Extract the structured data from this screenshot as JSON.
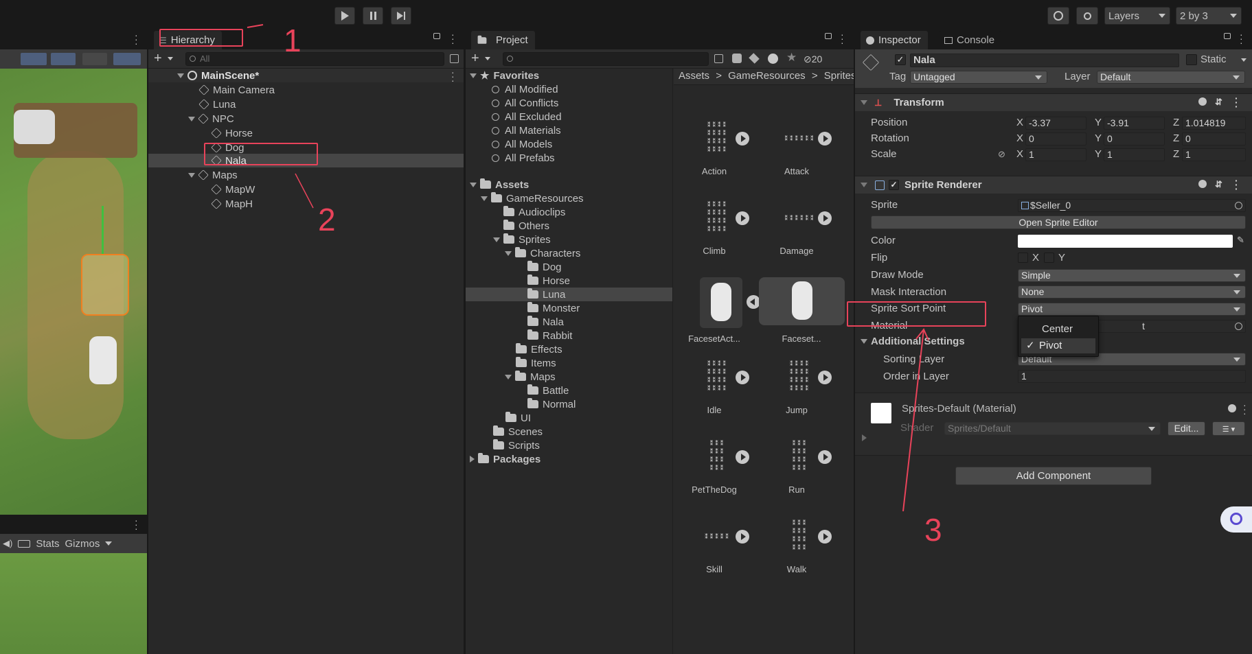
{
  "toolbar": {
    "layers_label": "Layers",
    "layout_label": "2 by 3"
  },
  "scene_view": {
    "bottom_bar": {
      "stats": "Stats",
      "gizmos": "Gizmos"
    }
  },
  "hierarchy": {
    "tab": "Hierarchy",
    "search_placeholder": "All",
    "scene_name": "MainScene*",
    "items": [
      {
        "label": "Main Camera",
        "depth": 1
      },
      {
        "label": "Luna",
        "depth": 1
      },
      {
        "label": "NPC",
        "depth": 1,
        "folded": false
      },
      {
        "label": "Horse",
        "depth": 2
      },
      {
        "label": "Dog",
        "depth": 2
      },
      {
        "label": "Nala",
        "depth": 2,
        "selected": true
      },
      {
        "label": "Maps",
        "depth": 1,
        "folded": false
      },
      {
        "label": "MapW",
        "depth": 2
      },
      {
        "label": "MapH",
        "depth": 2
      }
    ]
  },
  "project": {
    "tab": "Project",
    "hidden_count": "20",
    "favorites_label": "Favorites",
    "favorites": [
      "All Modified",
      "All Conflicts",
      "All Excluded",
      "All Materials",
      "All Models",
      "All Prefabs"
    ],
    "assets_label": "Assets",
    "tree": [
      {
        "label": "GameResources",
        "depth": 1,
        "open": true
      },
      {
        "label": "Audioclips",
        "depth": 2
      },
      {
        "label": "Others",
        "depth": 2
      },
      {
        "label": "Sprites",
        "depth": 2,
        "open": true
      },
      {
        "label": "Characters",
        "depth": 3,
        "open": true
      },
      {
        "label": "Dog",
        "depth": 4
      },
      {
        "label": "Horse",
        "depth": 4
      },
      {
        "label": "Luna",
        "depth": 4,
        "selected": true
      },
      {
        "label": "Monster",
        "depth": 4
      },
      {
        "label": "Nala",
        "depth": 4
      },
      {
        "label": "Rabbit",
        "depth": 4
      },
      {
        "label": "Effects",
        "depth": 3
      },
      {
        "label": "Items",
        "depth": 3
      },
      {
        "label": "Maps",
        "depth": 3,
        "open": true
      },
      {
        "label": "Battle",
        "depth": 4
      },
      {
        "label": "Normal",
        "depth": 4
      },
      {
        "label": "UI",
        "depth": 2
      },
      {
        "label": "Scenes",
        "depth": 1
      },
      {
        "label": "Scripts",
        "depth": 1
      }
    ],
    "packages_label": "Packages",
    "breadcrumb": [
      "Assets",
      "GameResources",
      "Sprites"
    ],
    "breadcrumb_sep": ">",
    "grid": [
      {
        "label": "Action"
      },
      {
        "label": "Attack"
      },
      {
        "label": "Climb"
      },
      {
        "label": "Damage"
      },
      {
        "label": "FacesetAct..."
      },
      {
        "label": "Faceset..."
      },
      {
        "label": "Idle"
      },
      {
        "label": "Jump"
      },
      {
        "label": "PetTheDog"
      },
      {
        "label": "Run"
      },
      {
        "label": "Skill"
      },
      {
        "label": "Walk"
      }
    ]
  },
  "inspector": {
    "tab": "Inspector",
    "console_tab": "Console",
    "object_name": "Nala",
    "static_label": "Static",
    "tag_label": "Tag",
    "tag_value": "Untagged",
    "layer_label": "Layer",
    "layer_value": "Default",
    "transform": {
      "title": "Transform",
      "position_label": "Position",
      "rotation_label": "Rotation",
      "scale_label": "Scale",
      "x": "X",
      "y": "Y",
      "z": "Z",
      "position": [
        "-3.37",
        "-3.91",
        "1.014819"
      ],
      "rotation": [
        "0",
        "0",
        "0"
      ],
      "scale": [
        "1",
        "1",
        "1"
      ]
    },
    "sprite_renderer": {
      "title": "Sprite Renderer",
      "sprite_label": "Sprite",
      "sprite_value": "$Seller_0",
      "open_editor": "Open Sprite Editor",
      "color_label": "Color",
      "flip_label": "Flip",
      "flip_x": "X",
      "flip_y": "Y",
      "draw_mode_label": "Draw Mode",
      "draw_mode_value": "Simple",
      "mask_label": "Mask Interaction",
      "mask_value": "None",
      "sort_point_label": "Sprite Sort Point",
      "sort_point_value": "Pivot",
      "material_label": "Material",
      "material_value_partial": "t",
      "additional_label": "Additional Settings",
      "sorting_layer_label": "Sorting Layer",
      "sorting_layer_value": "Default",
      "order_label": "Order in Layer",
      "order_value": "1",
      "popup_options": [
        "Center",
        "Pivot"
      ],
      "popup_selected": "Pivot",
      "popup_check": "✓"
    },
    "material": {
      "name": "Sprites-Default (Material)",
      "shader_label": "Shader",
      "shader_value": "Sprites/Default",
      "edit_button": "Edit..."
    },
    "add_component": "Add Component"
  },
  "annotations": {
    "n1": "1",
    "n2": "2",
    "n3": "3",
    "color": "#e8435a"
  }
}
